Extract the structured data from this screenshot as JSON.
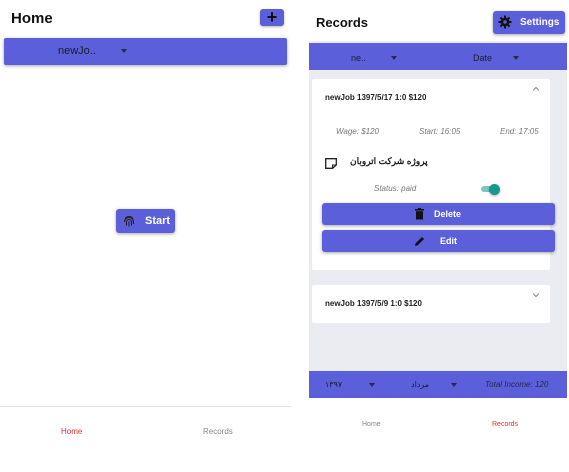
{
  "home": {
    "title": "Home",
    "add_label": "+",
    "job_select": {
      "value": "newJo.."
    },
    "start_label": "Start",
    "tabs": {
      "home": "Home",
      "records": "Records"
    }
  },
  "records": {
    "title": "Records",
    "settings_label": "Settings",
    "filter": {
      "job": "ne..",
      "date": "Date"
    },
    "cards": [
      {
        "header": "newJob 1397/5/17 1:0 $120",
        "wage": "Wage: $120",
        "start": "Start: 16:05",
        "end": "End: 17:05",
        "note": "پروژه شرکت اتروبان",
        "status": "Status: paid",
        "delete_label": "Delete",
        "edit_label": "Edit"
      },
      {
        "header": "newJob 1397/5/9 1:0 $120"
      }
    ],
    "footer": {
      "year": "۱۳۹۷",
      "month": "مرداد",
      "income": "Total Income: 120"
    },
    "tabs": {
      "home": "Home",
      "records": "Records"
    }
  },
  "colors": {
    "accent": "#5b5fd9",
    "active_tab": "#e0302a",
    "toggle": "#139a8b",
    "background": "#ebebf2"
  },
  "icons": [
    "plus-icon",
    "fingerprint-icon",
    "gear-icon",
    "chevron-up-icon",
    "chevron-down-icon",
    "note-icon",
    "trash-icon",
    "pencil-icon"
  ]
}
